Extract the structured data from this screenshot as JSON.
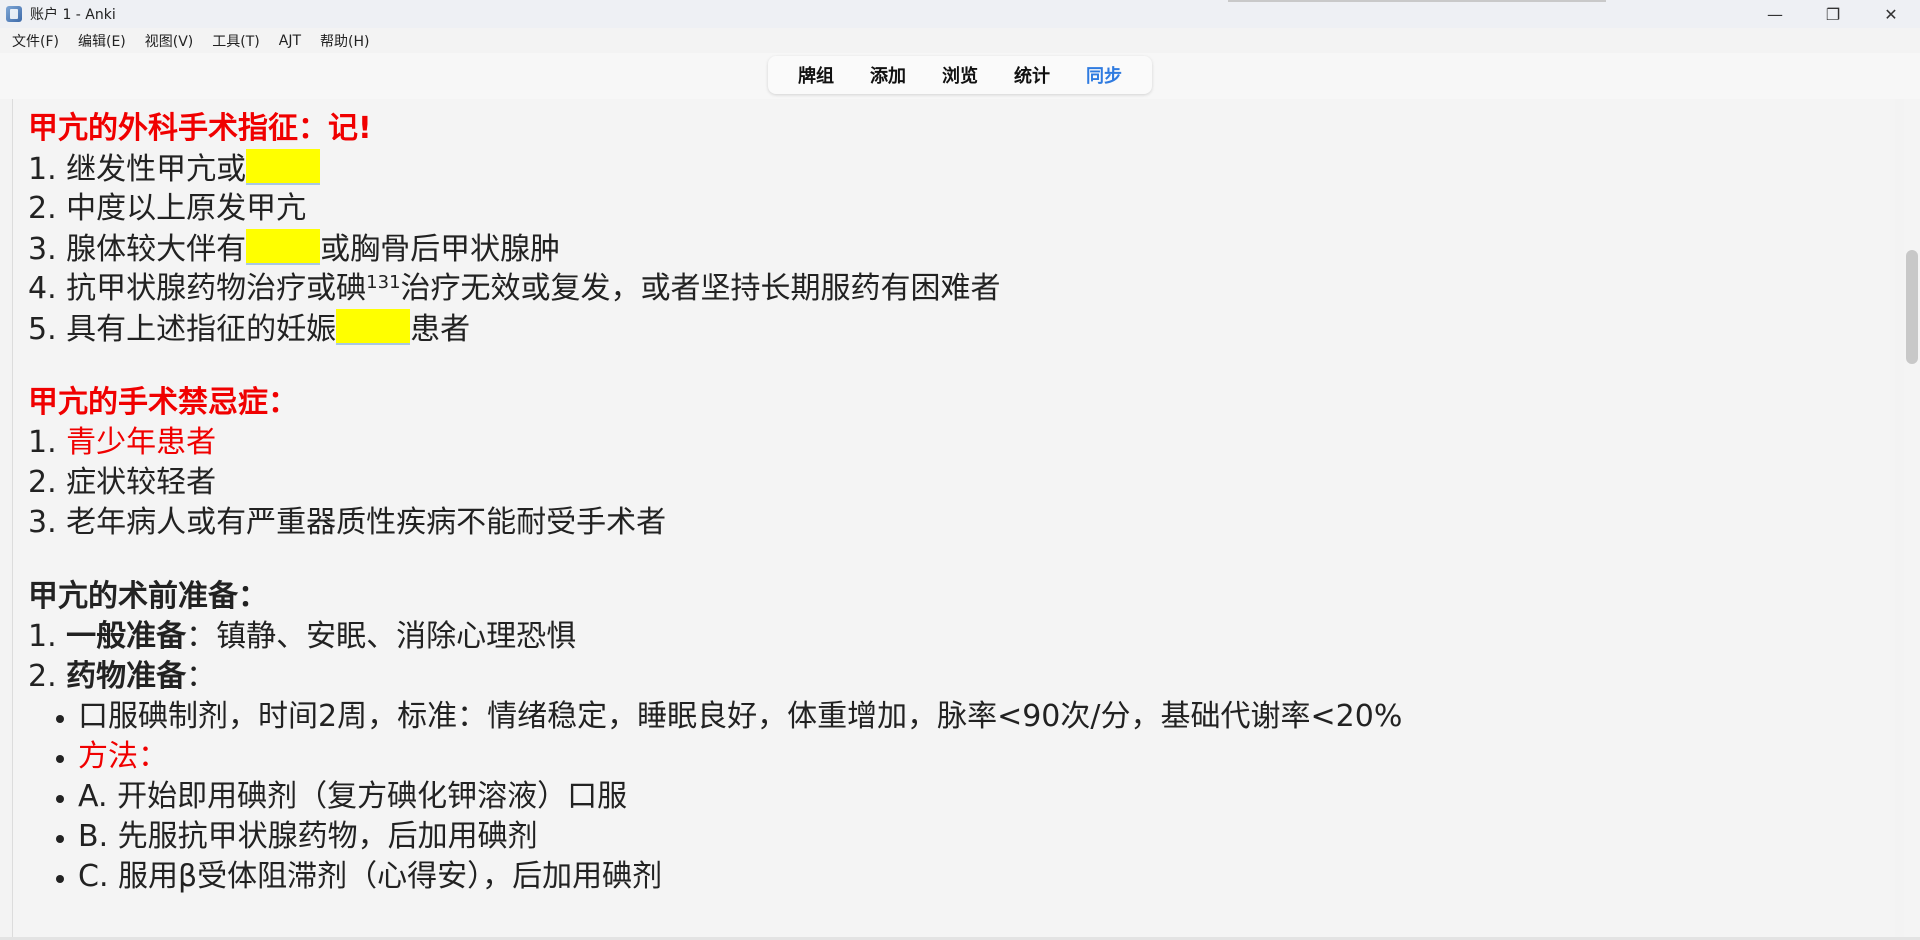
{
  "window": {
    "title": "账户 1 - Anki",
    "controls": {
      "minimize": "—",
      "maximize": "❐",
      "close": "✕"
    }
  },
  "menu": [
    "文件(F)",
    "编辑(E)",
    "视图(V)",
    "工具(T)",
    "AJT",
    "帮助(H)"
  ],
  "toolbar": {
    "items": [
      "牌组",
      "添加",
      "浏览",
      "统计",
      "同步"
    ],
    "active": "同步",
    "active_color": "#2f7be0"
  },
  "card": {
    "sec1": {
      "title": "甲亢的外科手术指征：记!",
      "l1_text": "1. 继发性甲亢或",
      "l2_text": "2. 中度以上原发甲亢",
      "l3_a": "3. 腺体较大伴有",
      "l3_b": "或胸骨后甲状腺肿",
      "l4_a": "4. 抗甲状腺药物治疗或碘",
      "l4_sup": "131",
      "l4_b": "治疗无效或复发，或者坚持长期服药有困难者",
      "l5_a": "5. 具有上述指征的妊娠",
      "l5_b": "患者"
    },
    "sec2": {
      "title": "甲亢的手术禁忌症：",
      "l1_num": "1. ",
      "l1_text": "青少年患者",
      "l2": "2. 症状较轻者",
      "l3": "3. 老年病人或有严重器质性疾病不能耐受手术者"
    },
    "sec3": {
      "title": "甲亢的术前准备：",
      "l1_num": "1. ",
      "l1_bold": "一般准备",
      "l1_rest": "：镇静、安眠、消除心理恐惧",
      "l2_num": "2. ",
      "l2_bold": "药物准备",
      "l2_rest": "：",
      "bullets": [
        "口服碘制剂，时间2周，标准：情绪稳定，睡眠良好，体重增加，脉率<90次/分，基础代谢率<20%",
        "方法：",
        "A. 开始即用碘剂（复方碘化钾溶液）口服",
        "B. 先服抗甲状腺药物，后加用碘剂",
        "C. 服用β受体阻滞剂（心得安），后加用碘剂"
      ]
    },
    "highlight_color": "#ffff00",
    "red_color": "#f00000"
  }
}
